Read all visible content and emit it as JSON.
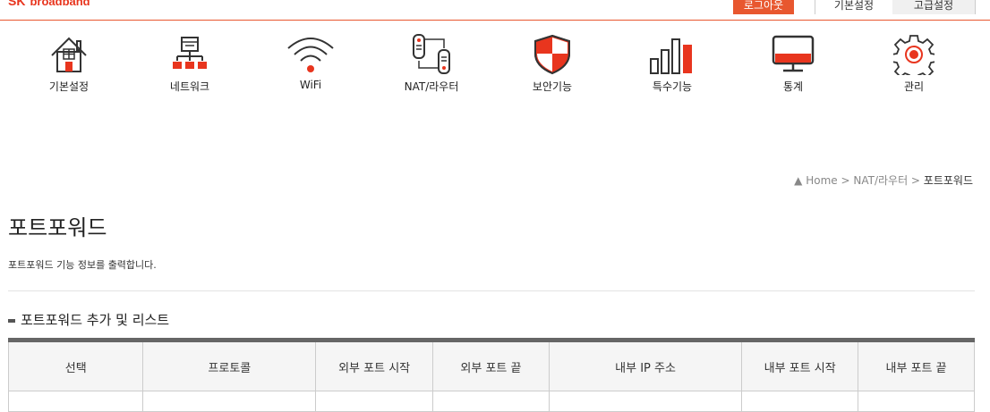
{
  "header": {
    "logo_sk": "SK",
    "logo_broadband": "broadband",
    "logout_label": "로그아웃",
    "basic_settings_label": "기본설정",
    "advanced_settings_label": "고급설정"
  },
  "menu": {
    "items": [
      {
        "label": "기본설정",
        "icon": "house-icon"
      },
      {
        "label": "네트워크",
        "icon": "network-icon"
      },
      {
        "label": "WiFi",
        "icon": "wifi-icon"
      },
      {
        "label": "NAT/라우터",
        "icon": "router-icon"
      },
      {
        "label": "보안기능",
        "icon": "shield-icon"
      },
      {
        "label": "특수기능",
        "icon": "bar-graph-icon"
      },
      {
        "label": "통계",
        "icon": "monitor-icon"
      },
      {
        "label": "관리",
        "icon": "gear-icon"
      }
    ]
  },
  "breadcrumb": {
    "home": "Home",
    "sep1": " > ",
    "section": "NAT/라우터",
    "sep2": " > ",
    "current": "포트포워드"
  },
  "page": {
    "title": "포트포워드",
    "description": "포트포워드 기능 정보를 출력합니다.",
    "section_title": "포트포워드 추가 및 리스트"
  },
  "table": {
    "headers": [
      "선택",
      "프로토콜",
      "외부 포트 시작",
      "외부 포트 끝",
      "내부 IP 주소",
      "내부 포트 시작",
      "내부 포트 끝"
    ]
  },
  "colors": {
    "accent": "#e8572f",
    "brand_red": "#e8351e"
  }
}
